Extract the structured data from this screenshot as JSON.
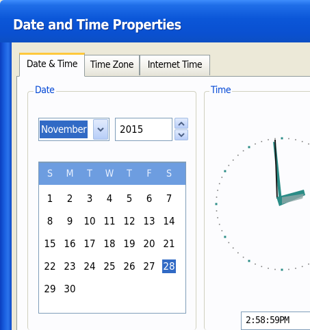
{
  "window": {
    "title": "Date and Time Properties"
  },
  "tabs": [
    {
      "label": "Date & Time",
      "active": true
    },
    {
      "label": "Time Zone",
      "active": false
    },
    {
      "label": "Internet Time",
      "active": false
    }
  ],
  "date_group": {
    "legend": "Date",
    "month": {
      "value": "November"
    },
    "year": {
      "value": "2015"
    }
  },
  "calendar": {
    "weekdays": [
      "S",
      "M",
      "T",
      "W",
      "T",
      "F",
      "S"
    ],
    "weeks": [
      [
        "1",
        "2",
        "3",
        "4",
        "5",
        "6",
        "7"
      ],
      [
        "8",
        "9",
        "10",
        "11",
        "12",
        "13",
        "14"
      ],
      [
        "15",
        "16",
        "17",
        "18",
        "19",
        "20",
        "21"
      ],
      [
        "22",
        "23",
        "24",
        "25",
        "26",
        "27",
        "28"
      ],
      [
        "29",
        "30",
        "",
        "",
        "",
        "",
        ""
      ]
    ],
    "selected_day": "28"
  },
  "time_group": {
    "legend": "Time",
    "time_value": "2:58:59PM"
  },
  "colors": {
    "titlebar": "#0b56d8",
    "selection": "#316ac5",
    "calendar_header": "#6d9de0",
    "clock_hands": "#2a8c86",
    "tab_highlight": "#ffc83c"
  },
  "icons": {
    "dropdown": "chevron-down-icon",
    "spin_up": "arrow-up-icon",
    "spin_down": "arrow-down-icon",
    "clock": "analog-clock-icon"
  }
}
